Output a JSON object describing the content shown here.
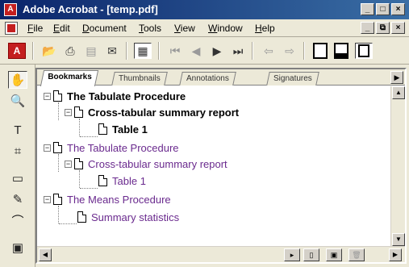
{
  "window": {
    "title": "Adobe Acrobat - [temp.pdf]",
    "app_icon": "acrobat-icon",
    "controls": {
      "minimize": "_",
      "maximize": "□",
      "close": "×"
    },
    "doc_controls": {
      "minimize": "_",
      "restore": "⧉",
      "close": "×"
    }
  },
  "menu": [
    "File",
    "Edit",
    "Document",
    "Tools",
    "View",
    "Window",
    "Help"
  ],
  "toolbar": {
    "icons": [
      "acrobat-logo-icon",
      "open-icon",
      "print-icon",
      "save-icon",
      "email-icon",
      "show-hide-navigation-icon",
      "first-page-icon",
      "previous-page-icon",
      "next-page-icon",
      "last-page-icon",
      "go-back-icon",
      "go-forward-icon",
      "single-page-icon",
      "continuous-icon",
      "facing-pages-icon"
    ],
    "acrobat_label": "A"
  },
  "left_tools": [
    "hand-tool-icon",
    "zoom-tool-icon",
    "text-select-tool-icon",
    "crop-tool-icon",
    "note-tool-icon",
    "pencil-tool-icon",
    "highlight-tool-icon",
    "form-tool-icon"
  ],
  "tabs": [
    {
      "label": "Bookmarks",
      "active": true
    },
    {
      "label": "Thumbnails",
      "active": false
    },
    {
      "label": "Annotations",
      "active": false
    },
    {
      "label": "Signatures",
      "active": false
    }
  ],
  "bookmarks": [
    {
      "label": "The Tabulate Procedure",
      "level": 0,
      "style": "bold",
      "expander": "−"
    },
    {
      "label": "Cross-tabular summary report",
      "level": 1,
      "style": "bold",
      "expander": "−"
    },
    {
      "label": "Table 1",
      "level": 2,
      "style": "bold",
      "expander": ""
    },
    {
      "label": "The Tabulate Procedure",
      "level": 0,
      "style": "purple",
      "expander": "−"
    },
    {
      "label": "Cross-tabular summary report",
      "level": 1,
      "style": "purple",
      "expander": "−"
    },
    {
      "label": "Table 1",
      "level": 2,
      "style": "purple",
      "expander": ""
    },
    {
      "label": "The Means Procedure",
      "level": 0,
      "style": "purple",
      "expander": "−"
    },
    {
      "label": "Summary statistics",
      "level": 1,
      "style": "purple",
      "expander": ""
    }
  ],
  "colors": {
    "titlebar_start": "#0a246a",
    "titlebar_end": "#3a6ea5",
    "visited_link": "#6a2a8e",
    "acrobat_red": "#c41f1f"
  }
}
